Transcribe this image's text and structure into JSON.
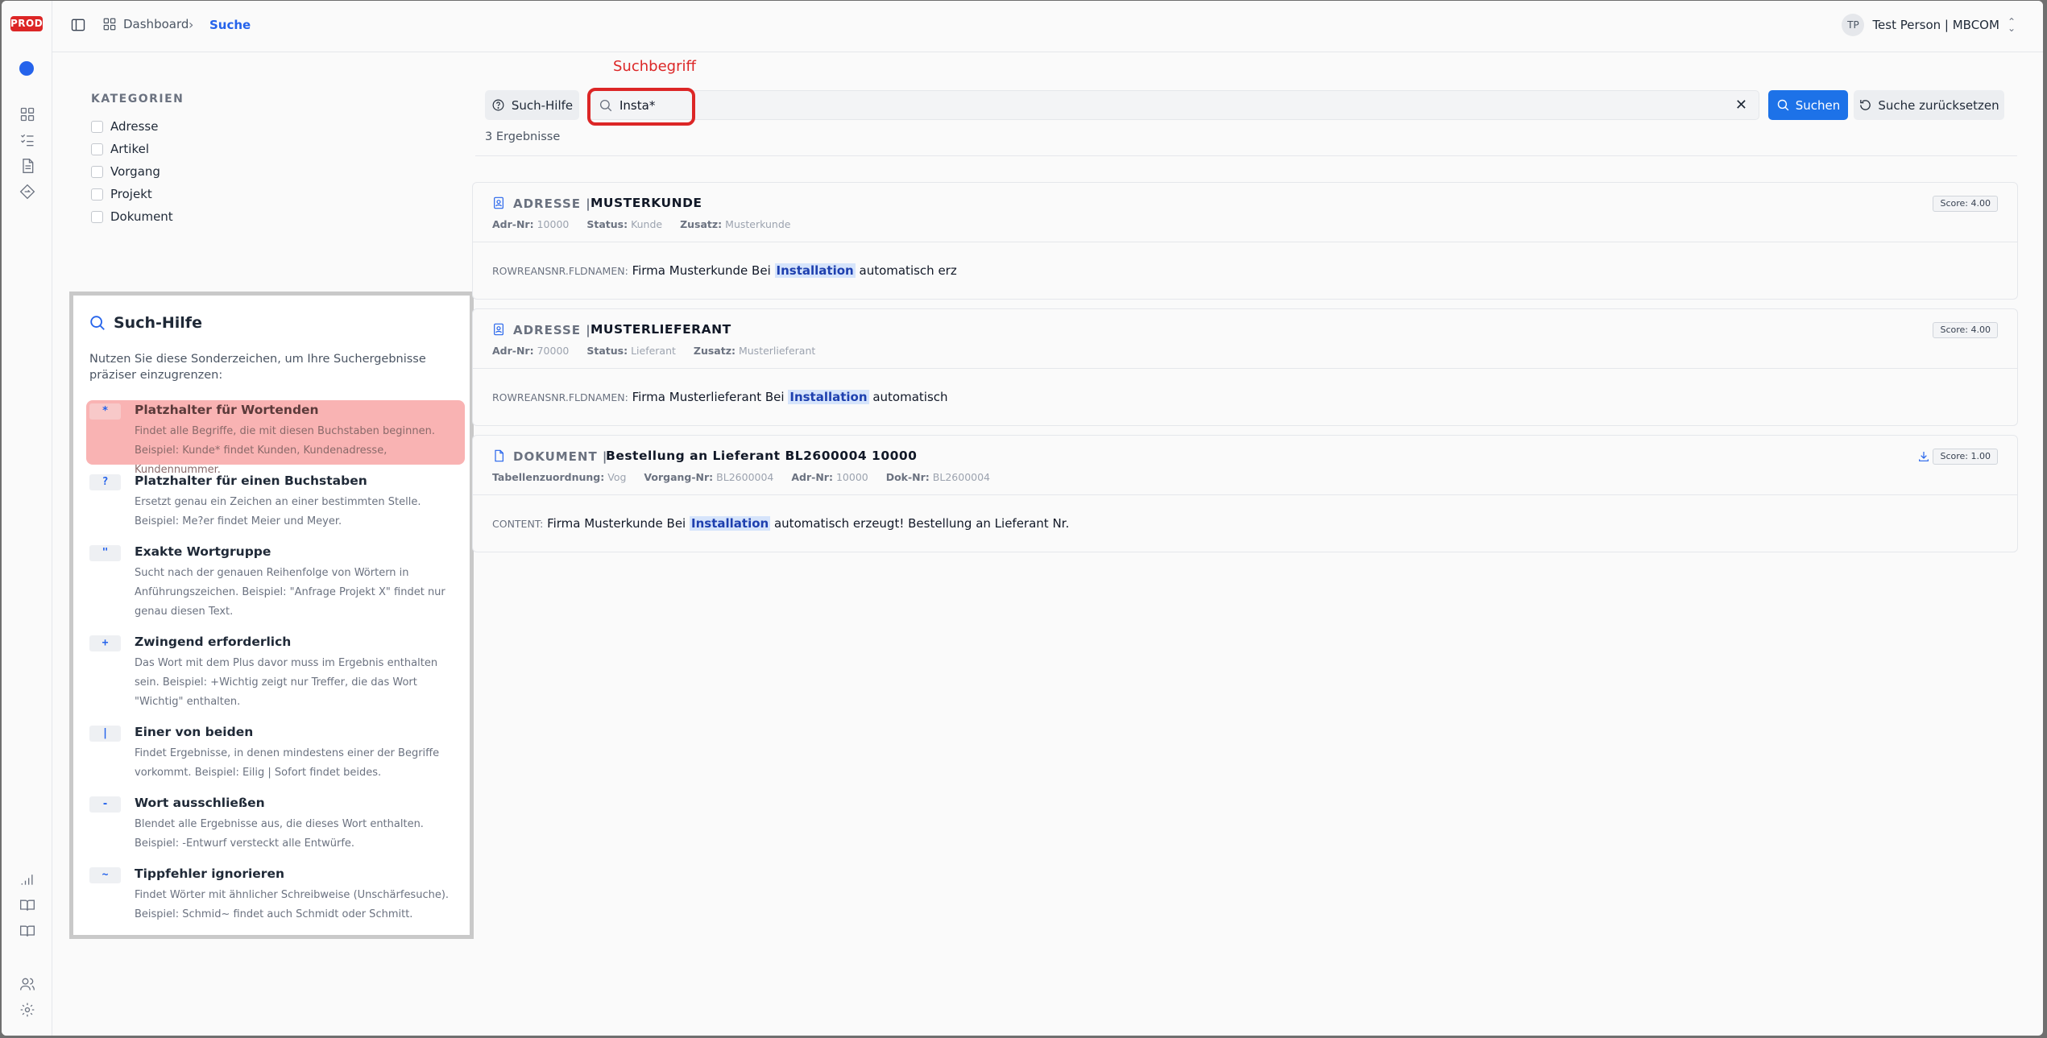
{
  "rail": {
    "env_badge": "PROD"
  },
  "breadcrumb": {
    "home": "Dashboard",
    "current": "Suche"
  },
  "user": {
    "initials": "TP",
    "name": "Test Person | MBCOM"
  },
  "categories": {
    "title": "KATEGORIEN",
    "items": [
      "Adresse",
      "Artikel",
      "Vorgang",
      "Projekt",
      "Dokument"
    ]
  },
  "annotation": {
    "label": "Suchbegriff"
  },
  "search": {
    "help_button": "Such-Hilfe",
    "value": "Insta*",
    "submit_label": "Suchen",
    "reset_label": "Suche zurücksetzen",
    "result_count": "3 Ergebnisse"
  },
  "help": {
    "title": "Such-Hilfe",
    "intro": "Nutzen Sie diese Sonderzeichen, um Ihre Suchergebnisse präziser einzugrenzen:",
    "items": [
      {
        "key": "*",
        "name": "Platzhalter für Wortenden",
        "desc": "Findet alle Begriffe, die mit diesen Buchstaben beginnen. Beispiel: Kunde* findet Kunden, Kundenadresse, Kundennummer."
      },
      {
        "key": "?",
        "name": "Platzhalter für einen Buchstaben",
        "desc": "Ersetzt genau ein Zeichen an einer bestimmten Stelle. Beispiel: Me?er findet Meier und Meyer."
      },
      {
        "key": "\"",
        "name": "Exakte Wortgruppe",
        "desc": "Sucht nach der genauen Reihenfolge von Wörtern in Anführungszeichen. Beispiel: \"Anfrage Projekt X\" findet nur genau diesen Text."
      },
      {
        "key": "+",
        "name": "Zwingend erforderlich",
        "desc": "Das Wort mit dem Plus davor muss im Ergebnis enthalten sein. Beispiel: +Wichtig zeigt nur Treffer, die das Wort \"Wichtig\" enthalten."
      },
      {
        "key": "|",
        "name": "Einer von beiden",
        "desc": "Findet Ergebnisse, in denen mindestens einer der Begriffe vorkommt. Beispiel: Eilig | Sofort findet beides."
      },
      {
        "key": "-",
        "name": "Wort ausschließen",
        "desc": "Blendet alle Ergebnisse aus, die dieses Wort enthalten. Beispiel: -Entwurf versteckt alle Entwürfe."
      },
      {
        "key": "~",
        "name": "Tippfehler ignorieren",
        "desc": "Findet Wörter mit ähnlicher Schreibweise (Unschärfesuche). Beispiel: Schmid~ findet auch Schmidt oder Schmitt."
      }
    ]
  },
  "results": [
    {
      "type": "ADRESSE |",
      "title": "MUSTERKUNDE",
      "score": "Score: 4.00",
      "meta": [
        {
          "label": "Adr-Nr:",
          "value": "10000"
        },
        {
          "label": "Status:",
          "value": "Kunde"
        },
        {
          "label": "Zusatz:",
          "value": "Musterkunde"
        }
      ],
      "field": "ROWREANSNR.FLDNAMEN:",
      "pre": "Firma Musterkunde Bei",
      "match": "Installation",
      "post": "automatisch erz"
    },
    {
      "type": "ADRESSE |",
      "title": "MUSTERLIEFERANT",
      "score": "Score: 4.00",
      "meta": [
        {
          "label": "Adr-Nr:",
          "value": "70000"
        },
        {
          "label": "Status:",
          "value": "Lieferant"
        },
        {
          "label": "Zusatz:",
          "value": "Musterlieferant"
        }
      ],
      "field": "ROWREANSNR.FLDNAMEN:",
      "pre": "Firma Musterlieferant Bei",
      "match": "Installation",
      "post": "automatisch"
    },
    {
      "type": "DOKUMENT |",
      "title": "Bestellung an Lieferant BL2600004 10000",
      "score": "Score: 1.00",
      "meta": [
        {
          "label": "Tabellenzuordnung:",
          "value": "Vog"
        },
        {
          "label": "Vorgang-Nr:",
          "value": "BL2600004"
        },
        {
          "label": "Adr-Nr:",
          "value": "10000"
        },
        {
          "label": "Dok-Nr:",
          "value": "BL2600004"
        }
      ],
      "field": "CONTENT:",
      "pre": "Firma Musterkunde Bei",
      "match": "Installation",
      "post": "automatisch erzeugt! Bestellung an Lieferant Nr."
    }
  ]
}
